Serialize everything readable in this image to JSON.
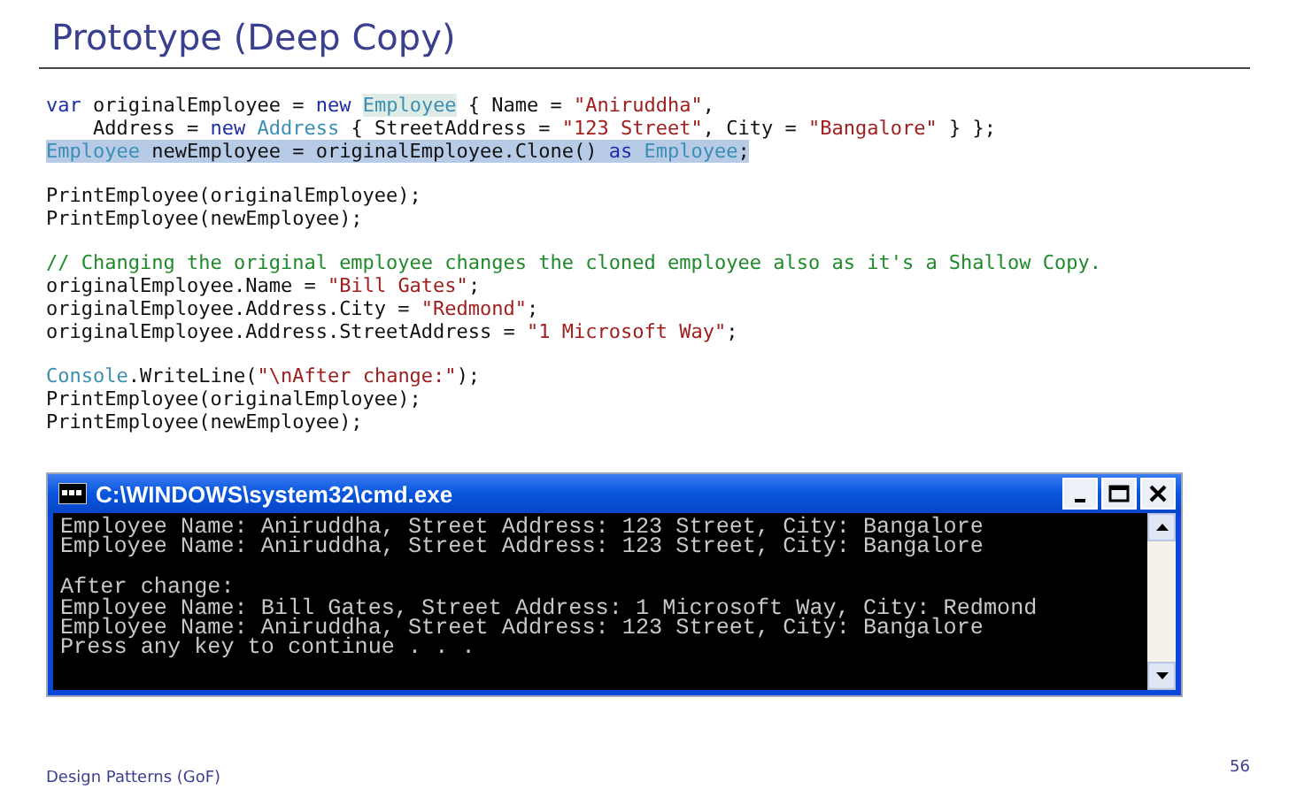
{
  "slide": {
    "title": "Prototype (Deep Copy)",
    "footer": "Design Patterns (GoF)",
    "page_number": "56"
  },
  "code_blocks": [
    {
      "lines": [
        {
          "highlighted": false,
          "tokens": [
            {
              "kind": "keyword",
              "text": "var"
            },
            {
              "kind": "plain",
              "text": " originalEmployee = "
            },
            {
              "kind": "keyword",
              "text": "new "
            },
            {
              "kind": "type-hl",
              "text": "Employee"
            },
            {
              "kind": "plain",
              "text": " { Name = "
            },
            {
              "kind": "string",
              "text": "\"Aniruddha\""
            },
            {
              "kind": "plain",
              "text": ","
            }
          ]
        },
        {
          "highlighted": false,
          "tokens": [
            {
              "kind": "plain",
              "text": "    Address = "
            },
            {
              "kind": "keyword",
              "text": "new "
            },
            {
              "kind": "type",
              "text": "Address"
            },
            {
              "kind": "plain",
              "text": " { StreetAddress = "
            },
            {
              "kind": "string",
              "text": "\"123 Street\""
            },
            {
              "kind": "plain",
              "text": ", City = "
            },
            {
              "kind": "string",
              "text": "\"Bangalore\""
            },
            {
              "kind": "plain",
              "text": " } };"
            }
          ]
        },
        {
          "highlighted": true,
          "tokens": [
            {
              "kind": "type",
              "text": "Employee"
            },
            {
              "kind": "plain",
              "text": " newEmployee = originalEmployee.Clone() "
            },
            {
              "kind": "keyword",
              "text": "as "
            },
            {
              "kind": "type",
              "text": "Employee"
            },
            {
              "kind": "plain",
              "text": ";"
            }
          ]
        }
      ]
    },
    {
      "lines": [
        {
          "highlighted": false,
          "tokens": [
            {
              "kind": "plain",
              "text": "PrintEmployee(originalEmployee);"
            }
          ]
        },
        {
          "highlighted": false,
          "tokens": [
            {
              "kind": "plain",
              "text": "PrintEmployee(newEmployee);"
            }
          ]
        }
      ]
    },
    {
      "lines": [
        {
          "highlighted": false,
          "tokens": [
            {
              "kind": "comment",
              "text": "// Changing the original employee changes the cloned employee also as it's a Shallow Copy."
            }
          ]
        },
        {
          "highlighted": false,
          "tokens": [
            {
              "kind": "plain",
              "text": "originalEmployee.Name = "
            },
            {
              "kind": "string",
              "text": "\"Bill Gates\""
            },
            {
              "kind": "plain",
              "text": ";"
            }
          ]
        },
        {
          "highlighted": false,
          "tokens": [
            {
              "kind": "plain",
              "text": "originalEmployee.Address.City = "
            },
            {
              "kind": "string",
              "text": "\"Redmond\""
            },
            {
              "kind": "plain",
              "text": ";"
            }
          ]
        },
        {
          "highlighted": false,
          "tokens": [
            {
              "kind": "plain",
              "text": "originalEmployee.Address.StreetAddress = "
            },
            {
              "kind": "string",
              "text": "\"1 Microsoft Way\""
            },
            {
              "kind": "plain",
              "text": ";"
            }
          ]
        }
      ]
    },
    {
      "lines": [
        {
          "highlighted": false,
          "tokens": [
            {
              "kind": "type",
              "text": "Console"
            },
            {
              "kind": "plain",
              "text": ".WriteLine("
            },
            {
              "kind": "string",
              "text": "\"\\nAfter change:\""
            },
            {
              "kind": "plain",
              "text": ");"
            }
          ]
        },
        {
          "highlighted": false,
          "tokens": [
            {
              "kind": "plain",
              "text": "PrintEmployee(originalEmployee);"
            }
          ]
        },
        {
          "highlighted": false,
          "tokens": [
            {
              "kind": "plain",
              "text": "PrintEmployee(newEmployee);"
            }
          ]
        }
      ]
    }
  ],
  "console": {
    "title": "C:\\WINDOWS\\system32\\cmd.exe",
    "blocks": [
      {
        "lines": [
          "Employee Name: Aniruddha, Street Address: 123 Street, City: Bangalore",
          "Employee Name: Aniruddha, Street Address: 123 Street, City: Bangalore"
        ]
      },
      {
        "lines": [
          "After change:",
          "Employee Name: Bill Gates, Street Address: 1 Microsoft Way, City: Redmond",
          "Employee Name: Aniruddha, Street Address: 123 Street, City: Bangalore",
          "Press any key to continue . . ."
        ]
      }
    ]
  }
}
